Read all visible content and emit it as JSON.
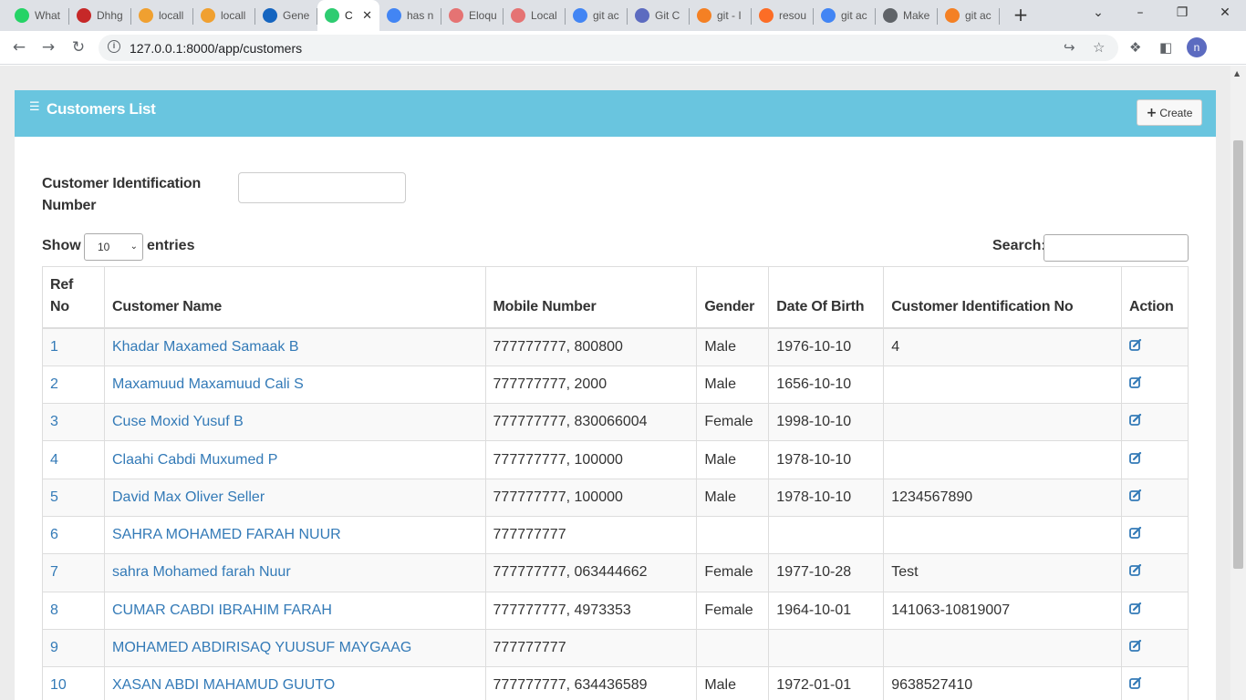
{
  "browser": {
    "tabs": [
      {
        "label": "What",
        "icon": "whatsapp-icon",
        "color": "#25d366"
      },
      {
        "label": "Dhhg",
        "icon": "gauge-icon",
        "color": "#c62828"
      },
      {
        "label": "locall",
        "icon": "phpmyadmin-icon",
        "color": "#f0a030"
      },
      {
        "label": "locall",
        "icon": "phpmyadmin-icon",
        "color": "#f0a030"
      },
      {
        "label": "Gene",
        "icon": "power-icon",
        "color": "#1565c0"
      },
      {
        "label": "C",
        "icon": "app-icon",
        "color": "#2ecc71",
        "active": true
      },
      {
        "label": "has n",
        "icon": "google-icon",
        "color": "#4285f4"
      },
      {
        "label": "Eloqu",
        "icon": "laravel-icon",
        "color": "#e57373"
      },
      {
        "label": "Local",
        "icon": "laravel-icon",
        "color": "#e57373"
      },
      {
        "label": "git ac",
        "icon": "google-icon",
        "color": "#4285f4"
      },
      {
        "label": "Git C",
        "icon": "star-icon",
        "color": "#5c6bc0"
      },
      {
        "label": "git - I",
        "icon": "stackoverflow-icon",
        "color": "#f48024"
      },
      {
        "label": "resou",
        "icon": "gitlab-icon",
        "color": "#fc6d26"
      },
      {
        "label": "git ac",
        "icon": "google-icon",
        "color": "#4285f4"
      },
      {
        "label": "Make",
        "icon": "globe-icon",
        "color": "#5f6368"
      },
      {
        "label": "git ac",
        "icon": "stackoverflow-icon",
        "color": "#f48024"
      }
    ],
    "url": "127.0.0.1:8000/app/customers",
    "profile_initial": "n"
  },
  "panel": {
    "title": "Customers List",
    "create_label": "Create"
  },
  "filter": {
    "label": "Customer Identification Number",
    "value": ""
  },
  "datatable": {
    "show_label": "Show",
    "page_size": "10",
    "entries_label": "entries",
    "search_label": "Search:",
    "search_value": "",
    "columns": [
      "Ref No",
      "Customer Name",
      "Mobile Number",
      "Gender",
      "Date Of Birth",
      "Customer Identification No",
      "Action"
    ],
    "rows": [
      {
        "ref": "1",
        "name": "Khadar Maxamed Samaak B",
        "mobile": "777777777, 800800",
        "gender": "Male",
        "dob": "1976-10-10",
        "cid": "4"
      },
      {
        "ref": "2",
        "name": "Maxamuud Maxamuud Cali S",
        "mobile": "777777777, 2000",
        "gender": "Male",
        "dob": "1656-10-10",
        "cid": ""
      },
      {
        "ref": "3",
        "name": "Cuse Moxid Yusuf B",
        "mobile": "777777777, 830066004",
        "gender": "Female",
        "dob": "1998-10-10",
        "cid": ""
      },
      {
        "ref": "4",
        "name": "Claahi Cabdi Muxumed P",
        "mobile": "777777777, 100000",
        "gender": "Male",
        "dob": "1978-10-10",
        "cid": ""
      },
      {
        "ref": "5",
        "name": "David Max Oliver Seller",
        "mobile": "777777777, 100000",
        "gender": "Male",
        "dob": "1978-10-10",
        "cid": "1234567890"
      },
      {
        "ref": "6",
        "name": "SAHRA MOHAMED FARAH NUUR",
        "mobile": "777777777",
        "gender": "",
        "dob": "",
        "cid": ""
      },
      {
        "ref": "7",
        "name": "sahra Mohamed farah Nuur",
        "mobile": "777777777, 063444662",
        "gender": "Female",
        "dob": "1977-10-28",
        "cid": "Test"
      },
      {
        "ref": "8",
        "name": "CUMAR CABDI IBRAHIM FARAH",
        "mobile": "777777777, 4973353",
        "gender": "Female",
        "dob": "1964-10-01",
        "cid": "141063-10819007"
      },
      {
        "ref": "9",
        "name": "MOHAMED ABDIRISAQ YUUSUF MAYGAAG",
        "mobile": "777777777",
        "gender": "",
        "dob": "",
        "cid": ""
      },
      {
        "ref": "10",
        "name": "XASAN ABDI MAHAMUD GUUTO",
        "mobile": "777777777, 634436589",
        "gender": "Male",
        "dob": "1972-01-01",
        "cid": "9638527410"
      }
    ]
  },
  "colors": {
    "panel_header": "#69c5df",
    "link": "#337ab7"
  }
}
